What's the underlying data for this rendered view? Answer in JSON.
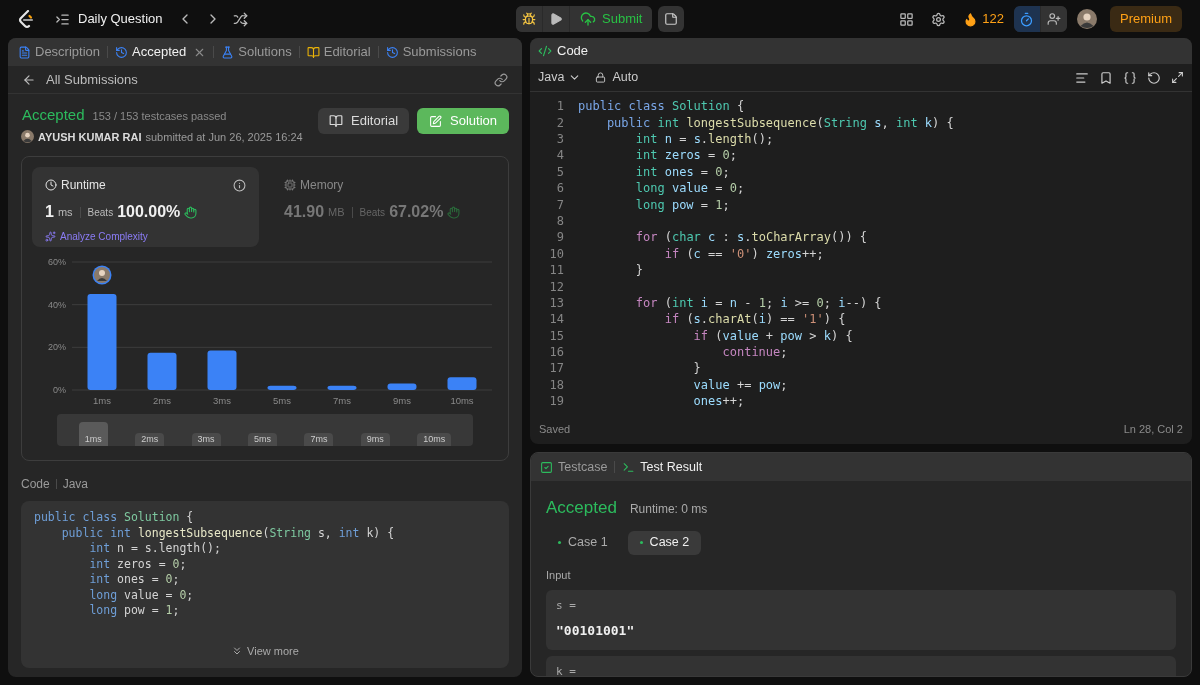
{
  "top_bar": {
    "title": "Daily Question",
    "submit": "Submit",
    "streak": "122",
    "premium": "Premium"
  },
  "left_panel": {
    "tabs": [
      {
        "label": "Description",
        "selected": false,
        "closable": false
      },
      {
        "label": "Accepted",
        "selected": true,
        "closable": true
      },
      {
        "label": "Solutions",
        "selected": false,
        "closable": false
      },
      {
        "label": "Editorial",
        "selected": false,
        "closable": false
      },
      {
        "label": "Submissions",
        "selected": false,
        "closable": false
      }
    ],
    "back_link": "All Submissions",
    "submission": {
      "status": "Accepted",
      "passed": "153 / 153 testcases passed",
      "user": "AYUSH KUMAR RAI",
      "submitted": "submitted at Jun 26, 2025 16:24",
      "buttons": [
        "Editorial",
        "Solution"
      ]
    },
    "metrics": [
      {
        "title": "Runtime",
        "value": "1",
        "unit": "ms",
        "beats_label": "Beats",
        "beats": "100.00%",
        "analyze": "Analyze Complexity",
        "selected": true
      },
      {
        "title": "Memory",
        "value": "41.90",
        "unit": "MB",
        "beats_label": "Beats",
        "beats": "67.02%",
        "selected": false
      }
    ],
    "chart_data": {
      "type": "bar",
      "categories": [
        "1ms",
        "2ms",
        "3ms",
        "5ms",
        "7ms",
        "9ms",
        "10ms"
      ],
      "series": [
        {
          "color": "#3b82f6",
          "values": [
            45,
            17.5,
            18.5,
            2,
            2,
            3,
            6
          ]
        }
      ],
      "ylim": [
        0,
        60
      ],
      "yticks": [
        {
          "value": 0,
          "label": "0%"
        },
        {
          "value": 20,
          "label": "20%"
        },
        {
          "value": 40,
          "label": "40%"
        },
        {
          "value": 60,
          "label": "60%"
        }
      ]
    },
    "range_labels": [
      {
        "label": "1ms",
        "selected": true
      },
      {
        "label": "2ms",
        "selected": false
      },
      {
        "label": "3ms",
        "selected": false
      },
      {
        "label": "5ms",
        "selected": false
      },
      {
        "label": "7ms",
        "selected": false
      },
      {
        "label": "9ms",
        "selected": false
      },
      {
        "label": "10ms",
        "selected": false
      }
    ],
    "code": {
      "title": "Code",
      "language": "Java",
      "lines": [
        [
          {
            "text": "public class ",
            "kind": "kw"
          },
          {
            "text": "Solution",
            "kind": "cls"
          },
          {
            "text": " {",
            "kind": "p"
          }
        ],
        [
          {
            "text": "    public ",
            "kind": "kw"
          },
          {
            "text": "int ",
            "kind": "kw"
          },
          {
            "text": "longestSubsequence",
            "kind": "fn"
          },
          {
            "text": "(",
            "kind": "p"
          },
          {
            "text": "String ",
            "kind": "cls"
          },
          {
            "text": "s, ",
            "kind": "p"
          },
          {
            "text": "int ",
            "kind": "kw"
          },
          {
            "text": "k) {",
            "kind": "p"
          }
        ],
        [
          {
            "text": "        int ",
            "kind": "kw"
          },
          {
            "text": "n = s.length();",
            "kind": "p"
          }
        ],
        [
          {
            "text": "        int ",
            "kind": "kw"
          },
          {
            "text": "zeros = ",
            "kind": "p"
          },
          {
            "text": "0",
            "kind": "num"
          },
          {
            "text": ";",
            "kind": "p"
          }
        ],
        [
          {
            "text": "        int ",
            "kind": "kw"
          },
          {
            "text": "ones = ",
            "kind": "p"
          },
          {
            "text": "0",
            "kind": "num"
          },
          {
            "text": ";",
            "kind": "p"
          }
        ],
        [
          {
            "text": "        long ",
            "kind": "kw"
          },
          {
            "text": "value = ",
            "kind": "p"
          },
          {
            "text": "0",
            "kind": "num"
          },
          {
            "text": ";",
            "kind": "p"
          }
        ],
        [
          {
            "text": "        long ",
            "kind": "kw"
          },
          {
            "text": "pow = ",
            "kind": "p"
          },
          {
            "text": "1",
            "kind": "num"
          },
          {
            "text": ";",
            "kind": "p"
          }
        ]
      ],
      "more": "View more"
    }
  },
  "editor": {
    "title": "Code",
    "language": "Java",
    "mode": "Auto",
    "lines": [
      {
        "number": "1",
        "tokens": [
          {
            "text": "public class ",
            "kind": "kw"
          },
          {
            "text": "Solution",
            "kind": "cls"
          },
          {
            "text": " {",
            "kind": "p"
          }
        ]
      },
      {
        "number": "2",
        "tokens": [
          {
            "text": "    public ",
            "kind": "kw"
          },
          {
            "text": "int ",
            "kind": "type"
          },
          {
            "text": "longestSubsequence",
            "kind": "fn"
          },
          {
            "text": "(",
            "kind": "p"
          },
          {
            "text": "String ",
            "kind": "cls"
          },
          {
            "text": "s",
            "kind": "var"
          },
          {
            "text": ", ",
            "kind": "p"
          },
          {
            "text": "int ",
            "kind": "type"
          },
          {
            "text": "k",
            "kind": "var"
          },
          {
            "text": ") {",
            "kind": "p"
          }
        ]
      },
      {
        "number": "3",
        "tokens": [
          {
            "text": "        int ",
            "kind": "type"
          },
          {
            "text": "n",
            "kind": "var"
          },
          {
            "text": " = ",
            "kind": "p"
          },
          {
            "text": "s",
            "kind": "var"
          },
          {
            "text": ".",
            "kind": "p"
          },
          {
            "text": "length",
            "kind": "fn"
          },
          {
            "text": "();",
            "kind": "p"
          }
        ]
      },
      {
        "number": "4",
        "tokens": [
          {
            "text": "        int ",
            "kind": "type"
          },
          {
            "text": "zeros",
            "kind": "var"
          },
          {
            "text": " = ",
            "kind": "p"
          },
          {
            "text": "0",
            "kind": "num"
          },
          {
            "text": ";",
            "kind": "p"
          }
        ]
      },
      {
        "number": "5",
        "tokens": [
          {
            "text": "        int ",
            "kind": "type"
          },
          {
            "text": "ones",
            "kind": "var"
          },
          {
            "text": " = ",
            "kind": "p"
          },
          {
            "text": "0",
            "kind": "num"
          },
          {
            "text": ";",
            "kind": "p"
          }
        ]
      },
      {
        "number": "6",
        "tokens": [
          {
            "text": "        long ",
            "kind": "type"
          },
          {
            "text": "value",
            "kind": "var"
          },
          {
            "text": " = ",
            "kind": "p"
          },
          {
            "text": "0",
            "kind": "num"
          },
          {
            "text": ";",
            "kind": "p"
          }
        ]
      },
      {
        "number": "7",
        "tokens": [
          {
            "text": "        long ",
            "kind": "type"
          },
          {
            "text": "pow",
            "kind": "var"
          },
          {
            "text": " = ",
            "kind": "p"
          },
          {
            "text": "1",
            "kind": "num"
          },
          {
            "text": ";",
            "kind": "p"
          }
        ]
      },
      {
        "number": "8"
      },
      {
        "number": "9",
        "tokens": [
          {
            "text": "        for ",
            "kind": "ctl"
          },
          {
            "text": "(",
            "kind": "p"
          },
          {
            "text": "char ",
            "kind": "type"
          },
          {
            "text": "c",
            "kind": "var"
          },
          {
            "text": " : ",
            "kind": "p"
          },
          {
            "text": "s",
            "kind": "var"
          },
          {
            "text": ".",
            "kind": "p"
          },
          {
            "text": "toCharArray",
            "kind": "fn"
          },
          {
            "text": "()) {",
            "kind": "p"
          }
        ]
      },
      {
        "number": "10",
        "tokens": [
          {
            "text": "            if ",
            "kind": "ctl"
          },
          {
            "text": "(",
            "kind": "p"
          },
          {
            "text": "c",
            "kind": "var"
          },
          {
            "text": " == ",
            "kind": "p"
          },
          {
            "text": "'0'",
            "kind": "str"
          },
          {
            "text": ") ",
            "kind": "p"
          },
          {
            "text": "zeros",
            "kind": "var"
          },
          {
            "text": "++;",
            "kind": "p"
          }
        ]
      },
      {
        "number": "11",
        "tokens": [
          {
            "text": "        }",
            "kind": "p"
          }
        ]
      },
      {
        "number": "12"
      },
      {
        "number": "13",
        "tokens": [
          {
            "text": "        for ",
            "kind": "ctl"
          },
          {
            "text": "(",
            "kind": "p"
          },
          {
            "text": "int ",
            "kind": "type"
          },
          {
            "text": "i",
            "kind": "var"
          },
          {
            "text": " = ",
            "kind": "p"
          },
          {
            "text": "n",
            "kind": "var"
          },
          {
            "text": " - ",
            "kind": "p"
          },
          {
            "text": "1",
            "kind": "num"
          },
          {
            "text": "; ",
            "kind": "p"
          },
          {
            "text": "i",
            "kind": "var"
          },
          {
            "text": " >= ",
            "kind": "p"
          },
          {
            "text": "0",
            "kind": "num"
          },
          {
            "text": "; ",
            "kind": "p"
          },
          {
            "text": "i",
            "kind": "var"
          },
          {
            "text": "--) {",
            "kind": "p"
          }
        ]
      },
      {
        "number": "14",
        "tokens": [
          {
            "text": "            if ",
            "kind": "ctl"
          },
          {
            "text": "(",
            "kind": "p"
          },
          {
            "text": "s",
            "kind": "var"
          },
          {
            "text": ".",
            "kind": "p"
          },
          {
            "text": "charAt",
            "kind": "fn"
          },
          {
            "text": "(",
            "kind": "p"
          },
          {
            "text": "i",
            "kind": "var"
          },
          {
            "text": ") == ",
            "kind": "p"
          },
          {
            "text": "'1'",
            "kind": "str"
          },
          {
            "text": ") {",
            "kind": "p"
          }
        ]
      },
      {
        "number": "15",
        "tokens": [
          {
            "text": "                if ",
            "kind": "ctl"
          },
          {
            "text": "(",
            "kind": "p"
          },
          {
            "text": "value",
            "kind": "var"
          },
          {
            "text": " + ",
            "kind": "p"
          },
          {
            "text": "pow",
            "kind": "var"
          },
          {
            "text": " > ",
            "kind": "p"
          },
          {
            "text": "k",
            "kind": "var"
          },
          {
            "text": ") {",
            "kind": "p"
          }
        ]
      },
      {
        "number": "16",
        "tokens": [
          {
            "text": "                    continue",
            "kind": "ctl"
          },
          {
            "text": ";",
            "kind": "p"
          }
        ]
      },
      {
        "number": "17",
        "tokens": [
          {
            "text": "                }",
            "kind": "p"
          }
        ]
      },
      {
        "number": "18",
        "tokens": [
          {
            "text": "                value",
            "kind": "var"
          },
          {
            "text": " += ",
            "kind": "p"
          },
          {
            "text": "pow",
            "kind": "var"
          },
          {
            "text": ";",
            "kind": "p"
          }
        ]
      },
      {
        "number": "19",
        "tokens": [
          {
            "text": "                ones",
            "kind": "var"
          },
          {
            "text": "++;",
            "kind": "p"
          }
        ]
      }
    ],
    "status": "Saved",
    "position": "Ln 28, Col 2"
  },
  "result_panel": {
    "tabs": [
      {
        "label": "Testcase",
        "selected": false
      },
      {
        "label": "Test Result",
        "selected": true
      }
    ],
    "status": "Accepted",
    "runtime": "Runtime: 0 ms",
    "cases": [
      {
        "label": "Case 1",
        "selected": false,
        "passed": true
      },
      {
        "label": "Case 2",
        "selected": true,
        "passed": true
      }
    ],
    "input_label": "Input",
    "params": [
      {
        "name": "s =",
        "value": "\"00101001\""
      },
      {
        "name": "k ="
      }
    ]
  }
}
